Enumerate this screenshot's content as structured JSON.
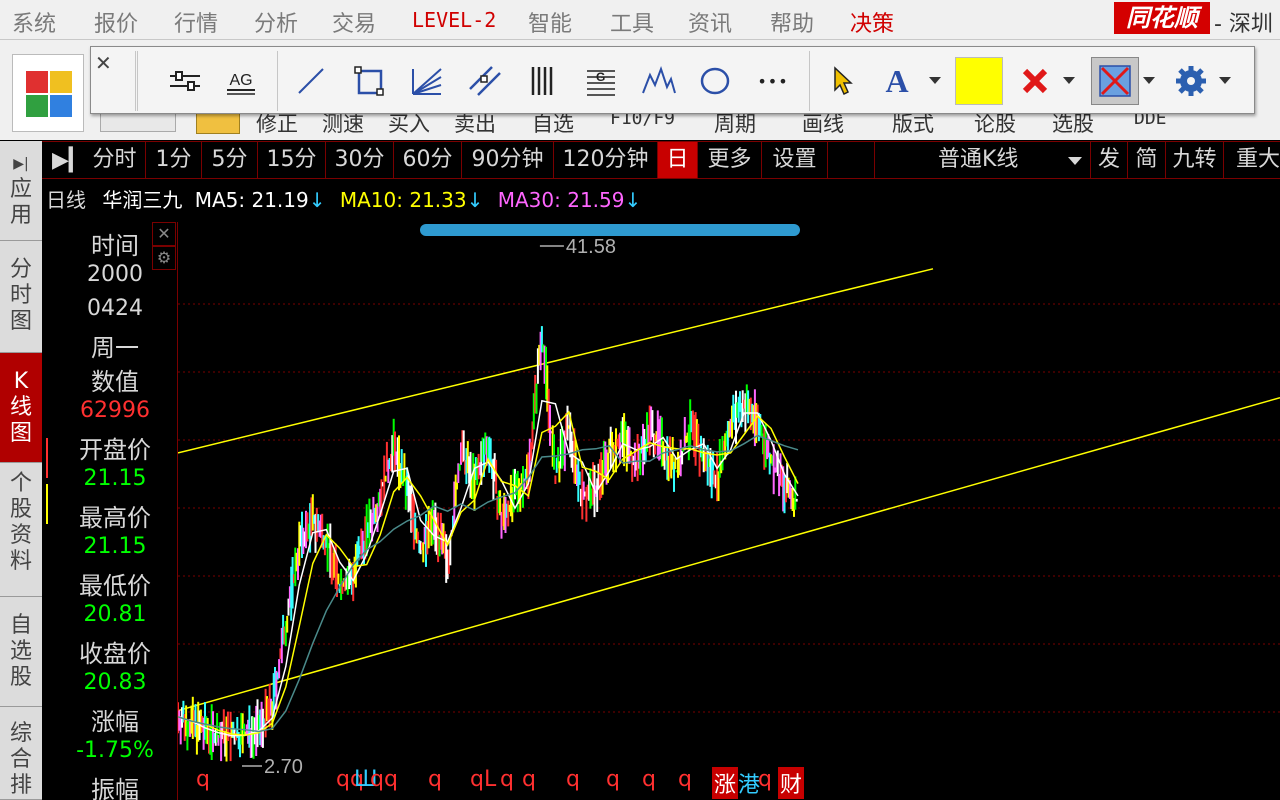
{
  "menu": {
    "items": [
      "系统",
      "报价",
      "行情",
      "分析",
      "交易",
      "LEVEL-2",
      "智能",
      "工具",
      "资讯",
      "帮助",
      "决策"
    ],
    "brand": "同花顺",
    "exchange": "- 深圳"
  },
  "toolbar2": {
    "labels": [
      "修正",
      "测速",
      "买入",
      "卖出",
      "自选",
      "F10/F9",
      "周期",
      "画线",
      "版式",
      "论股",
      "选股",
      "DDE"
    ]
  },
  "drawbar": {
    "close": "✕",
    "tools": [
      "parallel-lines",
      "ag-text",
      "line",
      "rectangle",
      "fan",
      "channel",
      "vertical-lines",
      "gann",
      "wave",
      "ellipse",
      "more",
      "pointer",
      "text",
      "color",
      "delete",
      "erase-all",
      "settings"
    ],
    "text_tool_glyph": "A",
    "ag_glyph": "AG",
    "color": "#ffff00",
    "more_glyph": "•••"
  },
  "periods": {
    "tabs": [
      "分时",
      "1分",
      "5分",
      "15分",
      "30分",
      "60分",
      "90分钟",
      "120分钟",
      "日",
      "更多",
      "设置"
    ],
    "active": "日",
    "kline_type": "普通K线",
    "right_tabs": [
      "发",
      "简",
      "九转",
      "重大"
    ]
  },
  "sidebar": {
    "items": [
      "应用",
      "分时图",
      "K线图",
      "个股资料",
      "自选股",
      "综合排"
    ],
    "active": "K线图"
  },
  "ma_legend": {
    "period": "日线",
    "stock": "华润三九",
    "ma5": "MA5: 21.19",
    "ma10": "MA10: 21.33",
    "ma30": "MA30: 21.59",
    "arrow": "↓",
    "colors": {
      "period": "#d8d8d8",
      "ma5": "#ffffff",
      "ma10": "#ffff00",
      "ma30": "#ff66ff",
      "arrow": "#33ccff"
    }
  },
  "info": {
    "time_label": "时间",
    "year": "2000",
    "date": "0424",
    "weekday": "周一",
    "value_label": "数值",
    "value": "62996",
    "open_label": "开盘价",
    "open": "21.15",
    "high_label": "最高价",
    "high": "21.15",
    "low_label": "最低价",
    "low": "20.81",
    "close_label": "收盘价",
    "close": "20.83",
    "change_label": "涨幅",
    "change": "-1.75%",
    "amplitude_label": "振幅",
    "colors": {
      "label": "#d8d8d8",
      "up": "#ff3030",
      "down": "#00ff00"
    }
  },
  "chart_data": {
    "type": "line",
    "high_label": "41.58",
    "low_label": "2.70",
    "series": [
      {
        "values": [
          4.5,
          3.8,
          3.4,
          3.0,
          2.9,
          3.1,
          3.6,
          5.2,
          12.0,
          18.5,
          20.5,
          19.0,
          15.2,
          16.0,
          19.5,
          22.5,
          26.5,
          23.0,
          18.0,
          20.5,
          17.0,
          26.0,
          23.5,
          27.0,
          20.5,
          22.5,
          24.5,
          36.0,
          24.0,
          28.0,
          22.5,
          23.0,
          26.0,
          27.5,
          25.0,
          28.0,
          26.5,
          24.5,
          28.0,
          25.5,
          24.0,
          28.5,
          30.0,
          28.5,
          25.5,
          23.0,
          22.0
        ]
      }
    ],
    "upper_channel": [
      [
        0,
        26.0
      ],
      [
        755,
        41.0
      ]
    ],
    "lower_channel": [
      [
        0,
        5.0
      ],
      [
        1102,
        30.5
      ]
    ],
    "event_markers": [
      "q",
      "qq",
      "Ш",
      "q",
      "q",
      "q",
      "qL",
      "q",
      "q",
      "q",
      "q",
      "q",
      "q",
      "涨",
      "港",
      "q",
      "财"
    ]
  }
}
